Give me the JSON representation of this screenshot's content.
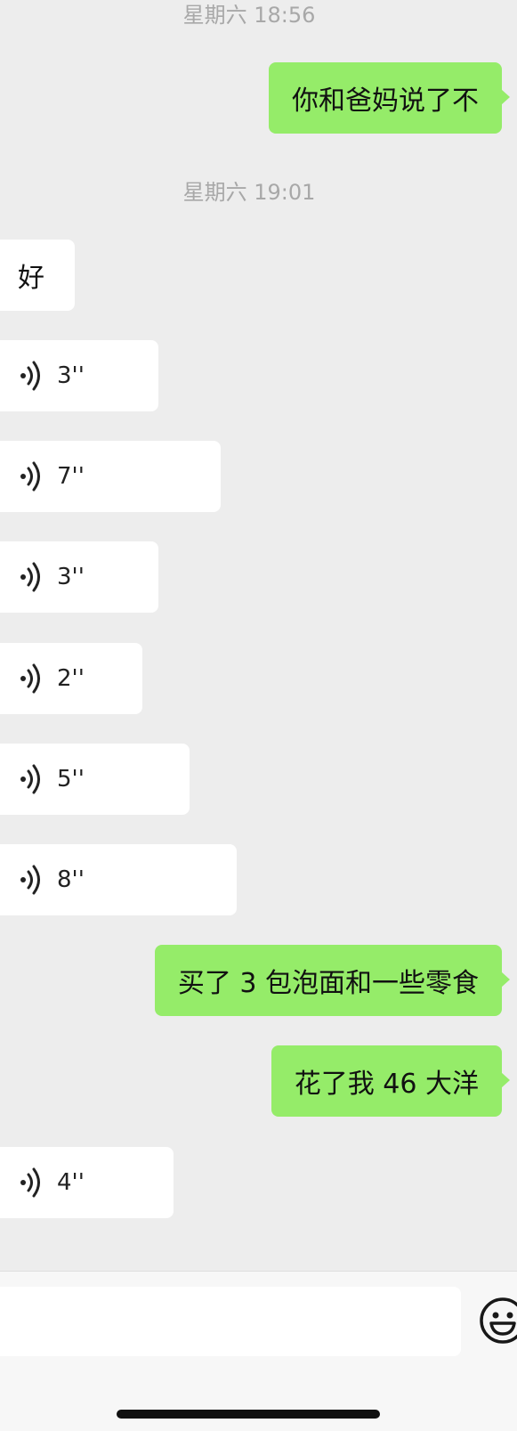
{
  "chat": {
    "timestamps": [
      "星期六 18:56",
      "星期六 19:01"
    ],
    "messages": [
      {
        "side": "out",
        "type": "text",
        "text": "你和爸妈说了不"
      },
      {
        "side": "in",
        "type": "text",
        "text": "好"
      },
      {
        "side": "in",
        "type": "voice",
        "duration": "3''"
      },
      {
        "side": "in",
        "type": "voice",
        "duration": "7''"
      },
      {
        "side": "in",
        "type": "voice",
        "duration": "3''"
      },
      {
        "side": "in",
        "type": "voice",
        "duration": "2''"
      },
      {
        "side": "in",
        "type": "voice",
        "duration": "5''"
      },
      {
        "side": "in",
        "type": "voice",
        "duration": "8''"
      },
      {
        "side": "out",
        "type": "text",
        "text": "买了 3 包泡面和一些零食"
      },
      {
        "side": "out",
        "type": "text",
        "text": "花了我 46 大洋"
      },
      {
        "side": "in",
        "type": "voice",
        "duration": "4''"
      }
    ]
  },
  "input_bar": {
    "input_value": "",
    "icons": [
      "emoji-icon"
    ]
  },
  "colors": {
    "background": "#ededed",
    "outgoing_bubble": "#95ec69",
    "incoming_bubble": "#ffffff",
    "timestamp_text": "#a8a8a8"
  }
}
